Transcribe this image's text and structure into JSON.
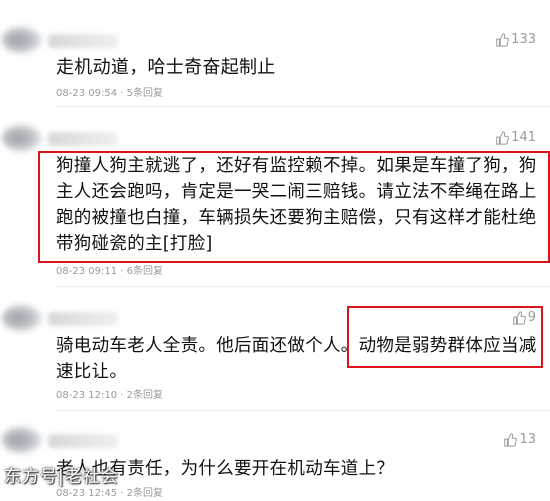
{
  "comments": [
    {
      "likes": "133",
      "text": "走机动道，哈士奇奋起制止",
      "meta": "08-23 09:54 · 5条回复"
    },
    {
      "likes": "141",
      "text_lines": [
        "狗撞人狗主就逃了，还好有监控赖不掉。如果是车撞了狗，狗",
        "主人还会跑吗，肯定是一哭二闹三赔钱。请立法不牵绳在路上",
        "跑的被撞也白撞，车辆损失还要狗主赔偿，只有这样才能杜绝",
        "带狗碰瓷的主[打脸]"
      ],
      "meta": "08-23 09:11 · 6条回复"
    },
    {
      "likes": "9",
      "text_lines": [
        "骑电动车老人全责。他后面还做个人。动物是弱势群体应当减",
        "速比让。"
      ],
      "meta": "08-23 12:10 · 2条回复"
    },
    {
      "likes": "13",
      "text": "老人也有责任，为什么要开在机动车道上？",
      "meta": "08-23 12:45 · 2条回复"
    }
  ],
  "watermark": "东方号|老社会",
  "colors": {
    "highlight": "#d9141b",
    "meta": "#9b9b9b",
    "text": "#111111"
  },
  "icons": {
    "like": "thumbs-up-icon"
  }
}
